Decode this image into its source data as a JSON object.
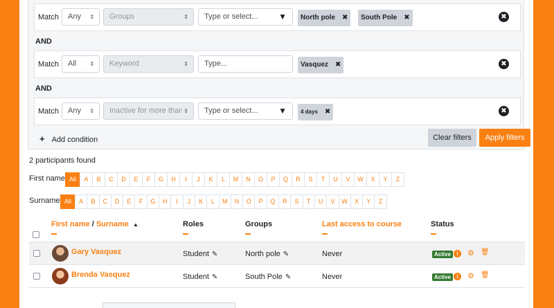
{
  "filters": {
    "rows": [
      {
        "match_label": "Match",
        "match_value": "Any",
        "type_value": "Groups",
        "value_placeholder": "Type or select...",
        "chips": [
          "North pole",
          "South Pole"
        ]
      },
      {
        "match_label": "Match",
        "match_value": "All",
        "type_value": "Keyword",
        "value_placeholder": "Type...",
        "chips": [
          "Vasquez"
        ]
      },
      {
        "match_label": "Match",
        "match_value": "Any",
        "type_value": "Inactive for more than",
        "value_placeholder": "Type or select...",
        "chips": [
          "4 days"
        ]
      }
    ],
    "join_label": "AND",
    "add_condition": "Add condition",
    "clear_label": "Clear filters",
    "apply_label": "Apply filters"
  },
  "participants_found": "2 participants found",
  "initials": {
    "first_name_label": "First name",
    "surname_label": "Surname",
    "letters": [
      "All",
      "A",
      "B",
      "C",
      "D",
      "E",
      "F",
      "G",
      "H",
      "I",
      "J",
      "K",
      "L",
      "M",
      "N",
      "O",
      "P",
      "Q",
      "R",
      "S",
      "T",
      "U",
      "V",
      "W",
      "X",
      "Y",
      "Z"
    ]
  },
  "table": {
    "col_first_name": "First name",
    "col_separator": " / ",
    "col_surname": "Surname",
    "col_roles": "Roles",
    "col_groups": "Groups",
    "col_last_access": "Last access to course",
    "col_status": "Status",
    "rows": [
      {
        "name": "Gary Vasquez",
        "role": "Student",
        "group": "North pole",
        "last_access": "Never",
        "status": "Active"
      },
      {
        "name": "Brenda Vasquez",
        "role": "Student",
        "group": "South Pole",
        "last_access": "Never",
        "status": "Active"
      }
    ]
  },
  "icons": {
    "sort": "▲",
    "remove": "✖",
    "chip_close": "✖",
    "plus": "+",
    "pencil": "✎",
    "info": "i",
    "gear": "⚙",
    "trash": "🗑",
    "updown": "⇕",
    "dropdown": "▼"
  },
  "colors": {
    "accent": "#f98012",
    "active_badge": "#357a32"
  }
}
